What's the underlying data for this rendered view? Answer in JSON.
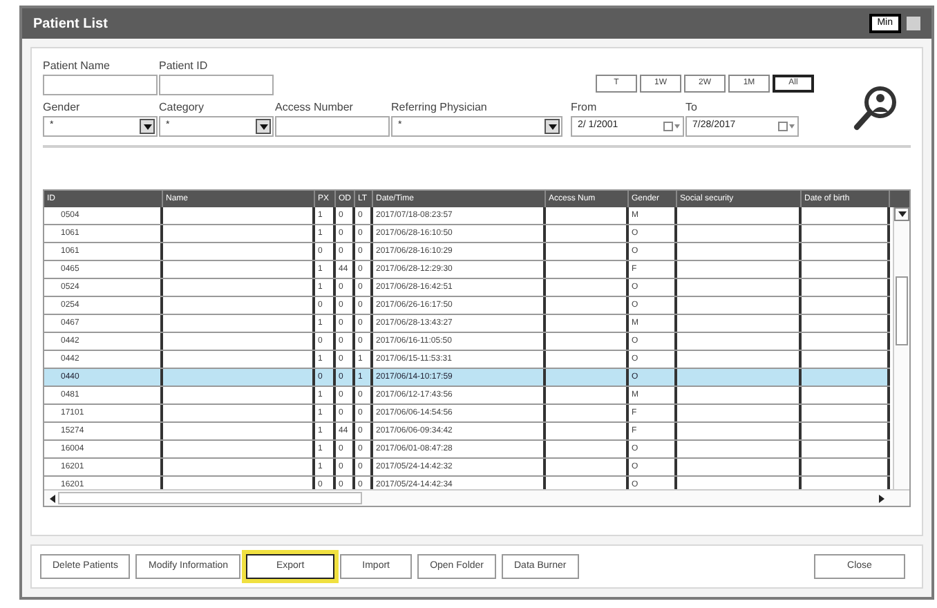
{
  "window": {
    "title": "Patient List",
    "title_button": "Min"
  },
  "filters": {
    "patient_name": {
      "label": "Patient Name"
    },
    "patient_id": {
      "label": "Patient ID"
    },
    "gender": {
      "label": "Gender",
      "value": "*"
    },
    "category": {
      "label": "Category",
      "value": "*"
    },
    "access_number": {
      "label": "Access Number"
    },
    "referring_physician": {
      "label": "Referring Physician",
      "value": "*"
    },
    "from": {
      "label": "From",
      "value": "2/ 1/2001"
    },
    "to": {
      "label": "To",
      "value": "7/28/2017"
    },
    "ranges": [
      {
        "label": "T",
        "selected": false
      },
      {
        "label": "1W",
        "selected": false
      },
      {
        "label": "2W",
        "selected": false
      },
      {
        "label": "1M",
        "selected": false
      },
      {
        "label": "All",
        "selected": true
      }
    ]
  },
  "table": {
    "columns": [
      "ID",
      "Name",
      "PX",
      "OD",
      "LT",
      "Date/Time",
      "Access Num",
      "Gender",
      "Social security",
      "Date of birth"
    ],
    "rows": [
      {
        "selected": false,
        "cells": [
          "0504",
          "",
          "1",
          "0",
          "0",
          "2017/07/18-08:23:57",
          "",
          "M",
          "",
          ""
        ]
      },
      {
        "selected": false,
        "cells": [
          "1061",
          "",
          "1",
          "0",
          "0",
          "2017/06/28-16:10:50",
          "",
          "O",
          "",
          ""
        ]
      },
      {
        "selected": false,
        "cells": [
          "1061",
          "",
          "0",
          "0",
          "0",
          "2017/06/28-16:10:29",
          "",
          "O",
          "",
          ""
        ]
      },
      {
        "selected": false,
        "cells": [
          "0465",
          "",
          "1",
          "44",
          "0",
          "2017/06/28-12:29:30",
          "",
          "F",
          "",
          ""
        ]
      },
      {
        "selected": false,
        "cells": [
          "0524",
          "",
          "1",
          "0",
          "0",
          "2017/06/28-16:42:51",
          "",
          "O",
          "",
          ""
        ]
      },
      {
        "selected": false,
        "cells": [
          "0254",
          "",
          "0",
          "0",
          "0",
          "2017/06/26-16:17:50",
          "",
          "O",
          "",
          ""
        ]
      },
      {
        "selected": false,
        "cells": [
          "0467",
          "",
          "1",
          "0",
          "0",
          "2017/06/28-13:43:27",
          "",
          "M",
          "",
          ""
        ]
      },
      {
        "selected": false,
        "cells": [
          "0442",
          "",
          "0",
          "0",
          "0",
          "2017/06/16-11:05:50",
          "",
          "O",
          "",
          ""
        ]
      },
      {
        "selected": false,
        "cells": [
          "0442",
          "",
          "1",
          "0",
          "1",
          "2017/06/15-11:53:31",
          "",
          "O",
          "",
          ""
        ]
      },
      {
        "selected": true,
        "cells": [
          "0440",
          "",
          "0",
          "0",
          "1",
          "2017/06/14-10:17:59",
          "",
          "O",
          "",
          ""
        ]
      },
      {
        "selected": false,
        "cells": [
          "0481",
          "",
          "1",
          "0",
          "0",
          "2017/06/12-17:43:56",
          "",
          "M",
          "",
          ""
        ]
      },
      {
        "selected": false,
        "cells": [
          "17101",
          "",
          "1",
          "0",
          "0",
          "2017/06/06-14:54:56",
          "",
          "F",
          "",
          ""
        ]
      },
      {
        "selected": false,
        "cells": [
          "15274",
          "",
          "1",
          "44",
          "0",
          "2017/06/06-09:34:42",
          "",
          "F",
          "",
          ""
        ]
      },
      {
        "selected": false,
        "cells": [
          "16004",
          "",
          "1",
          "0",
          "0",
          "2017/06/01-08:47:28",
          "",
          "O",
          "",
          ""
        ]
      },
      {
        "selected": false,
        "cells": [
          "16201",
          "",
          "1",
          "0",
          "0",
          "2017/05/24-14:42:32",
          "",
          "O",
          "",
          ""
        ]
      },
      {
        "selected": false,
        "cells": [
          "16201",
          "",
          "0",
          "0",
          "0",
          "2017/05/24-14:42:34",
          "",
          "O",
          "",
          ""
        ]
      }
    ]
  },
  "buttons": [
    {
      "label": "Delete Patients",
      "highlighted": false
    },
    {
      "label": "Modify Information",
      "highlighted": false
    },
    {
      "label": "Export",
      "highlighted": true
    },
    {
      "label": "Import",
      "highlighted": false
    },
    {
      "label": "Open Folder",
      "highlighted": false
    },
    {
      "label": "Data Burner",
      "highlighted": false
    },
    {
      "label": "Close",
      "highlighted": false
    }
  ]
}
